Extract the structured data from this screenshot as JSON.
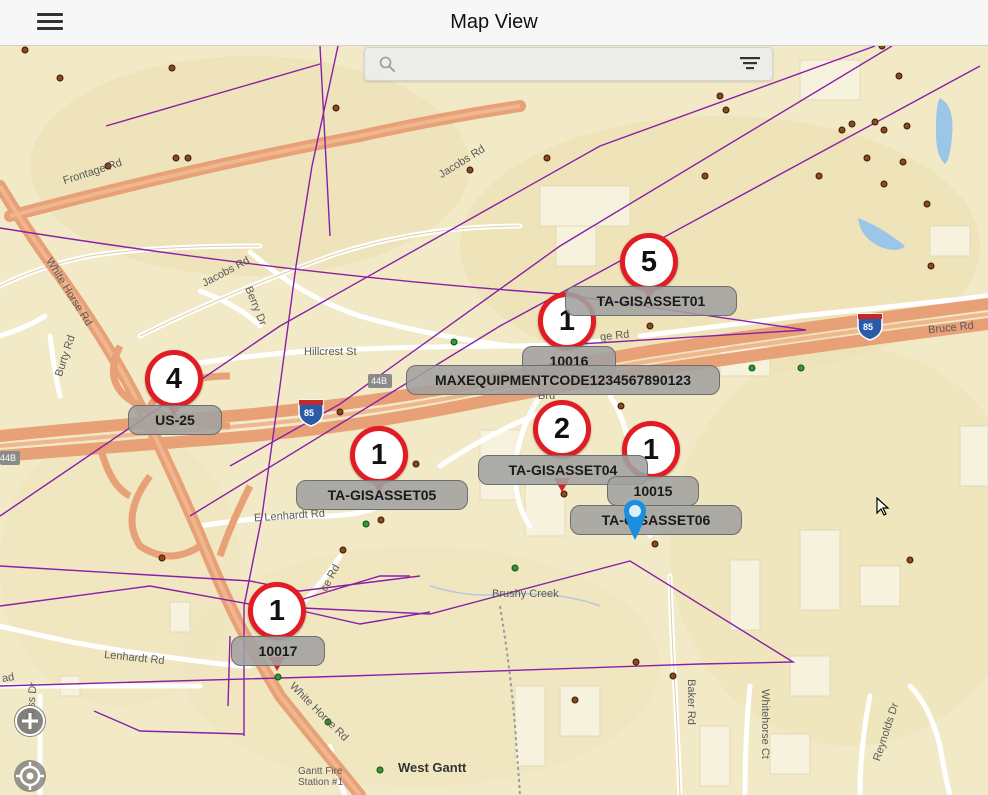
{
  "nav": {
    "title": "Map View",
    "menu_icon": "hamburger-menu-icon"
  },
  "search": {
    "placeholder": "",
    "value": "",
    "search_icon": "search-icon",
    "filter_icon": "filter-icon"
  },
  "colors": {
    "pin_ring": "#e21c24",
    "label_bg": "#a0a0a0",
    "utility_line": "#8a1fa8",
    "highway": "#e8925a",
    "blue_marker": "#1a8fe0"
  },
  "clusters": [
    {
      "count": "5",
      "label": "TA-GISASSET01"
    },
    {
      "count": "1",
      "label": "10016"
    },
    {
      "count": "",
      "label": "MAXEQUIPMENTCODE1234567890123"
    },
    {
      "count": "4",
      "label": "US-25"
    },
    {
      "count": "1",
      "label": "TA-GISASSET05"
    },
    {
      "count": "2",
      "label": "TA-GISASSET04"
    },
    {
      "count": "1",
      "label": "10015"
    },
    {
      "count": "",
      "label": "TA-GISASSET06"
    },
    {
      "count": "1",
      "label": "10017"
    }
  ],
  "map_labels": {
    "frontage_rd": "Frontage Rd",
    "jacobs_rd_top": "Jacobs Rd",
    "white_horse_rd_top": "White Horse Rd",
    "jacobs_rd_mid": "Jacobs Rd",
    "berry_dr": "Berry Dr",
    "hillcrest_st": "Hillcrest St",
    "frontage_rd_mid": "ge Rd",
    "bruce_rd": "Bruce Rd",
    "burty_rd": "Burty Rd",
    "i85_shield_left": "85",
    "i85_shield_right": "85",
    "exit_44b_top": "44B",
    "exit_44b_left": "44B",
    "e_lenhardt_rd": "E Lenhardt Rd",
    "brushy_creek": "Brushy Creek",
    "lenhardt_rd": "Lenhardt Rd",
    "white_horse_rd_bottom": "White Horse Rd",
    "baker_rd": "Baker Rd",
    "whitehorse_ct": "Whitehorse Ct",
    "reynolds_dr": "Reynolds Dr",
    "west_gantt": "West Gantt",
    "gantt_fire_station": "Gantt Fire\nStation #1",
    "ross_dr": "Ross Dr",
    "fragment_bru": "Bru",
    "fragment_ce_rd": "ce Rd",
    "fragment_ad": "ad"
  },
  "controls": {
    "zoom_in_icon": "zoom-in-icon",
    "locate_icon": "locate-me-icon"
  }
}
